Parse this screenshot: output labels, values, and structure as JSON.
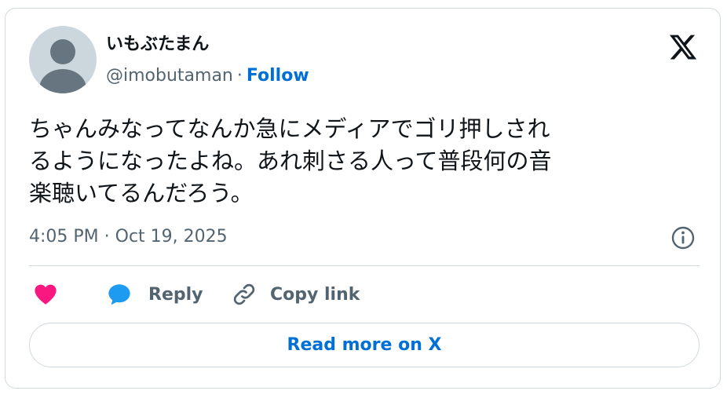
{
  "author": {
    "display_name": "いもぶたまん",
    "handle": "@imobutaman",
    "separator": "·",
    "follow_label": "Follow"
  },
  "tweet": {
    "lines": [
      "ちゃんみなってなんか急にメディアでゴリ押しされ",
      "るようになったよね。あれ刺さる人って普段何の音",
      "楽聴いてるんだろう。"
    ],
    "timestamp": "4:05 PM · Oct 19, 2025"
  },
  "actions": {
    "like_icon": "heart-icon",
    "reply_label": "Reply",
    "reply_icon": "speech-bubble-icon",
    "copy_link_label": "Copy link",
    "copy_link_icon": "link-icon"
  },
  "footer": {
    "read_more_label": "Read more on X"
  },
  "icons": {
    "brand": "x-logo-icon",
    "info": "info-icon"
  },
  "colors": {
    "like": "#f91880",
    "reply": "#1d9bf0",
    "link": "#006fd6",
    "muted": "#536471",
    "border": "#cfd9de"
  }
}
